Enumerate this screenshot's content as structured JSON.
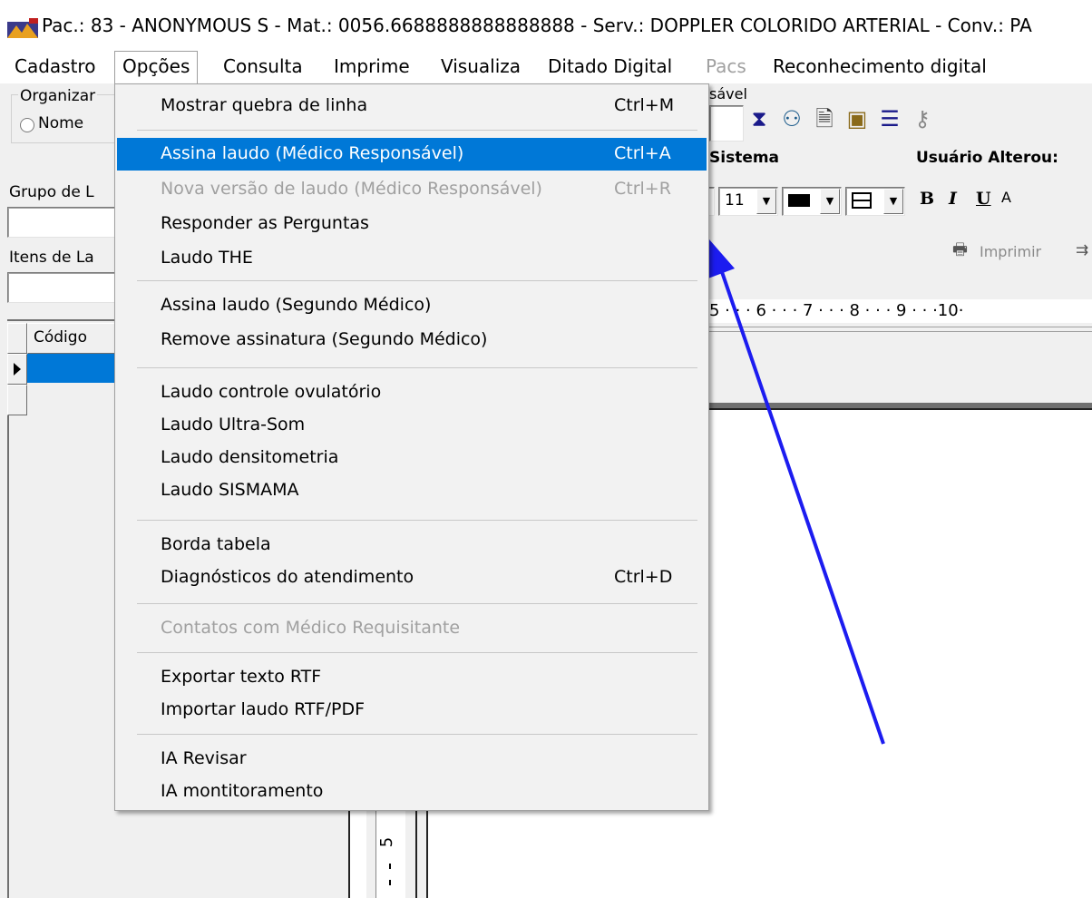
{
  "window": {
    "title": "Pac.: 83 - ANONYMOUS S - Mat.: 0056.6688888888888888 - Serv.: DOPPLER COLORIDO ARTERIAL - Conv.: PA"
  },
  "menubar": [
    {
      "label": "Cadastro",
      "state": "normal"
    },
    {
      "label": "Opções",
      "state": "open"
    },
    {
      "label": "Consulta",
      "state": "normal"
    },
    {
      "label": "Imprime",
      "state": "normal"
    },
    {
      "label": "Visualiza",
      "state": "normal"
    },
    {
      "label": "Ditado Digital",
      "state": "normal"
    },
    {
      "label": "Pacs",
      "state": "disabled"
    },
    {
      "label": "Reconhecimento digital",
      "state": "normal"
    }
  ],
  "left_panel": {
    "organize_group_label": "Organizar",
    "radio_nome_label": "Nome",
    "grupo_label": "Grupo de L",
    "itens_label": "Itens de La",
    "grid_header_codigo": "Código"
  },
  "toolbar": {
    "responsavel_label": "sável",
    "sistema_label": "Sistema",
    "usuario_alterou_label": "Usuário Alterou:",
    "font_size_value": "11",
    "bold_label": "B",
    "italic_label": "I",
    "underline_label": "U",
    "superscript_label": "A",
    "print_label": "Imprimir",
    "icons": [
      "hourglass-icon",
      "users-icon",
      "document-icon",
      "stamp-icon",
      "list-icon",
      "key-icon"
    ]
  },
  "ruler": {
    "text": "5 · · · 6 · · · 7 · · · 8 · · · 9 · · ·10·"
  },
  "vertical_ruler": {
    "text": "5"
  },
  "dropdown": {
    "items": [
      {
        "label": "Mostrar quebra de linha",
        "shortcut": "Ctrl+M",
        "state": "normal"
      },
      {
        "label": "Assina laudo (Médico Responsável)",
        "shortcut": "Ctrl+A",
        "state": "highlight"
      },
      {
        "label": "Nova versão de laudo (Médico Responsável)",
        "shortcut": "Ctrl+R",
        "state": "disabled"
      },
      {
        "label": "Responder as Perguntas",
        "shortcut": "",
        "state": "normal"
      },
      {
        "label": "Laudo THE",
        "shortcut": "",
        "state": "normal"
      },
      {
        "label": "Assina laudo (Segundo Médico)",
        "shortcut": "",
        "state": "normal"
      },
      {
        "label": "Remove assinatura (Segundo Médico)",
        "shortcut": "",
        "state": "normal"
      },
      {
        "label": "Laudo controle ovulatório",
        "shortcut": "",
        "state": "normal"
      },
      {
        "label": "Laudo Ultra-Som",
        "shortcut": "",
        "state": "normal"
      },
      {
        "label": "Laudo densitometria",
        "shortcut": "",
        "state": "normal"
      },
      {
        "label": "Laudo SISMAMA",
        "shortcut": "",
        "state": "normal"
      },
      {
        "label": "Borda tabela",
        "shortcut": "",
        "state": "normal"
      },
      {
        "label": "Diagnósticos do atendimento",
        "shortcut": "Ctrl+D",
        "state": "normal"
      },
      {
        "label": "Contatos com Médico Requisitante",
        "shortcut": "",
        "state": "disabled"
      },
      {
        "label": "Exportar texto RTF",
        "shortcut": "",
        "state": "normal"
      },
      {
        "label": "Importar laudo RTF/PDF",
        "shortcut": "",
        "state": "normal"
      },
      {
        "label": "IA Revisar",
        "shortcut": "",
        "state": "normal"
      },
      {
        "label": "IA montitoramento",
        "shortcut": "",
        "state": "normal"
      }
    ]
  },
  "colors": {
    "highlight": "#0078d7",
    "arrow": "#1c1cf0",
    "disabled_text": "#a0a0a0"
  }
}
